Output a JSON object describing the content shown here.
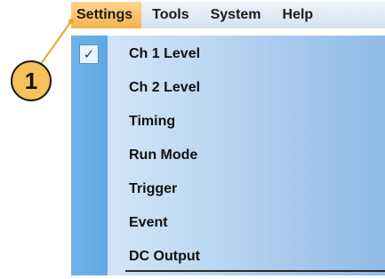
{
  "menubar": {
    "items": [
      {
        "label": "Settings",
        "active": true
      },
      {
        "label": "Tools",
        "active": false
      },
      {
        "label": "System",
        "active": false
      },
      {
        "label": "Help",
        "active": false
      }
    ]
  },
  "settings_menu": {
    "items": [
      {
        "label": "Ch 1 Level",
        "checked": true
      },
      {
        "label": "Ch 2 Level",
        "checked": false
      },
      {
        "label": "Timing",
        "checked": false
      },
      {
        "label": "Run Mode",
        "checked": false
      },
      {
        "label": "Trigger",
        "checked": false
      },
      {
        "label": "Event",
        "checked": false
      },
      {
        "label": "DC Output",
        "checked": false
      }
    ],
    "check_glyph": "✓"
  },
  "callout": {
    "number": "1"
  },
  "colors": {
    "active_menu": "#f4b24d",
    "gutter": "#5ea8e3",
    "callout": "#f6c15a"
  }
}
